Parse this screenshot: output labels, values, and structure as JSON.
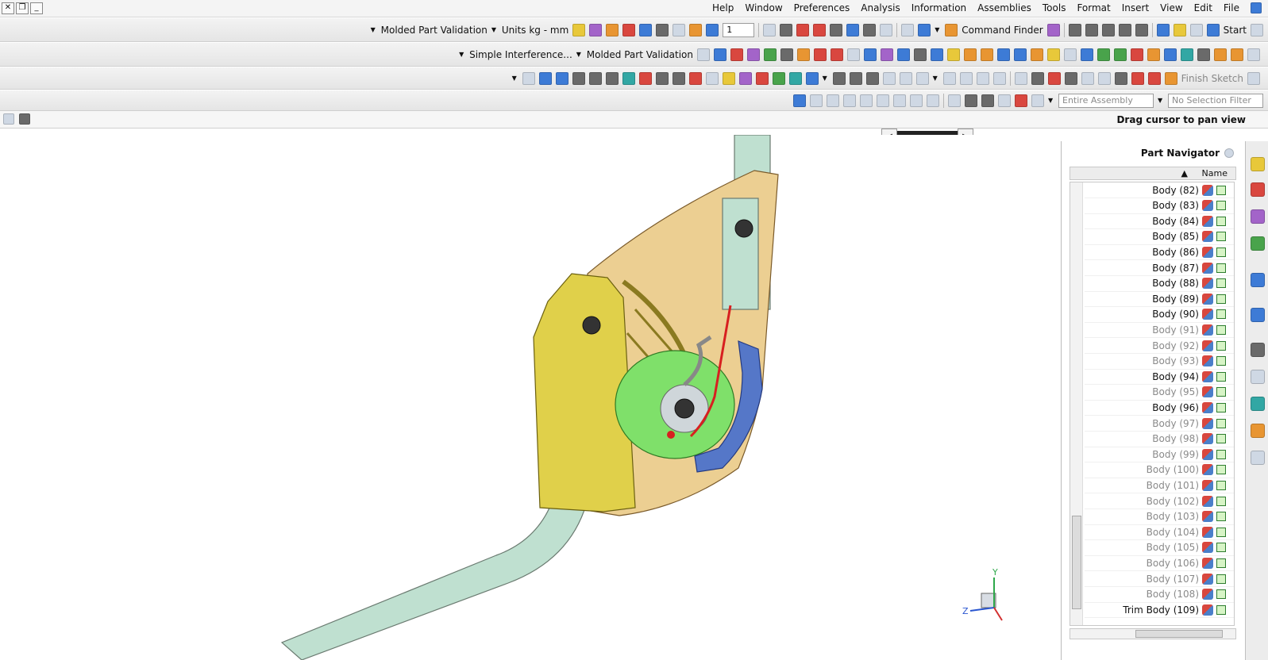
{
  "menubar": {
    "items": [
      "File",
      "Edit",
      "View",
      "Insert",
      "Format",
      "Tools",
      "Assemblies",
      "Information",
      "Analysis",
      "Preferences",
      "Window",
      "Help"
    ]
  },
  "toolbar1": {
    "start_label": "Start",
    "command_finder": "Command Finder",
    "layer_value": "1",
    "units": "Units kg - mm",
    "molded_part_validation": "Molded Part Validation"
  },
  "toolbar2": {
    "molded_part_validation": "Molded Part Validation",
    "simple_interference": "Simple Interference..."
  },
  "toolbar3": {
    "finish_sketch": "Finish Sketch"
  },
  "selectionbar": {
    "filter": "No Selection Filter",
    "scope": "Entire Assembly"
  },
  "status": {
    "text": "Drag cursor to pan view"
  },
  "navigator": {
    "title": "Part Navigator",
    "column": "Name",
    "rows": [
      {
        "label": "Body (82)",
        "dim": false
      },
      {
        "label": "Body (83)",
        "dim": false
      },
      {
        "label": "Body (84)",
        "dim": false
      },
      {
        "label": "Body (85)",
        "dim": false
      },
      {
        "label": "Body (86)",
        "dim": false
      },
      {
        "label": "Body (87)",
        "dim": false
      },
      {
        "label": "Body (88)",
        "dim": false
      },
      {
        "label": "Body (89)",
        "dim": false
      },
      {
        "label": "Body (90)",
        "dim": false
      },
      {
        "label": "Body (91)",
        "dim": true
      },
      {
        "label": "Body (92)",
        "dim": true
      },
      {
        "label": "Body (93)",
        "dim": true
      },
      {
        "label": "Body (94)",
        "dim": false
      },
      {
        "label": "Body (95)",
        "dim": true
      },
      {
        "label": "Body (96)",
        "dim": false
      },
      {
        "label": "Body (97)",
        "dim": true
      },
      {
        "label": "Body (98)",
        "dim": true
      },
      {
        "label": "Body (99)",
        "dim": true
      },
      {
        "label": "Body (100)",
        "dim": true
      },
      {
        "label": "Body (101)",
        "dim": true
      },
      {
        "label": "Body (102)",
        "dim": true
      },
      {
        "label": "Body (103)",
        "dim": true
      },
      {
        "label": "Body (104)",
        "dim": true
      },
      {
        "label": "Body (105)",
        "dim": true
      },
      {
        "label": "Body (106)",
        "dim": true
      },
      {
        "label": "Body (107)",
        "dim": true
      },
      {
        "label": "Body (108)",
        "dim": true
      },
      {
        "label": "Trim Body (109)",
        "dim": false
      }
    ]
  },
  "triad": {
    "x": "Z",
    "y": "Y"
  },
  "colors": {
    "yellow_part": "#e0d04a",
    "tan_part": "#eccf92",
    "green_part": "#7fe06a",
    "blue_part": "#5577c8",
    "shaft": "#bfe0d0",
    "accent": "#d72020"
  }
}
